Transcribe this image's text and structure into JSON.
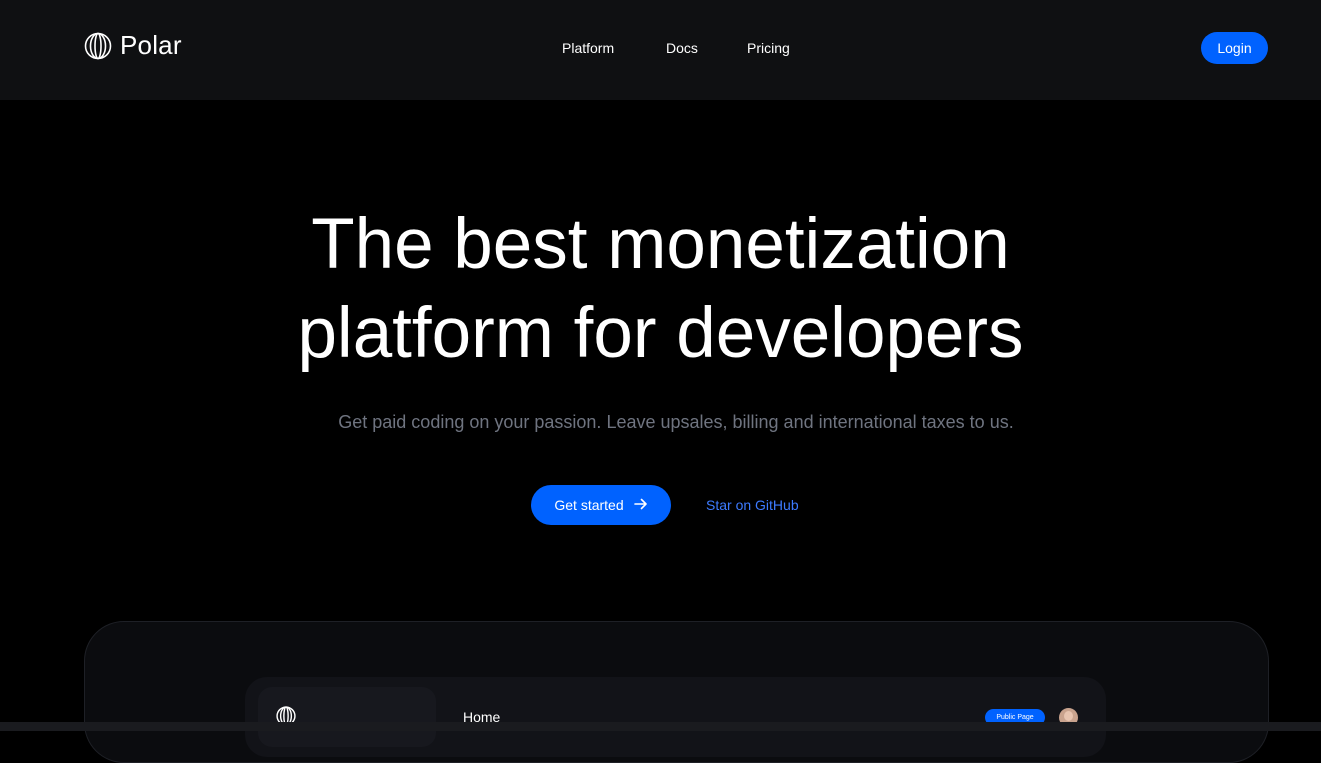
{
  "header": {
    "brand": "Polar",
    "logo_icon": "polar-globe-icon",
    "nav": [
      "Platform",
      "Docs",
      "Pricing"
    ],
    "login": "Login"
  },
  "hero": {
    "title_line1": "The best monetization",
    "title_line2": "platform for developers",
    "subtitle": "Get paid coding on your passion. Leave upsales, billing and international taxes to us.",
    "cta_primary": "Get started",
    "cta_primary_icon": "arrow-right-icon",
    "cta_secondary": "Star on GitHub"
  },
  "preview": {
    "page_title": "Home",
    "badge": "Public Page",
    "logo_icon": "polar-globe-icon",
    "avatar_icon": "user-avatar"
  },
  "colors": {
    "accent": "#0062ff",
    "link": "#3d7bff",
    "subtitle": "#6f7480",
    "background": "#000000",
    "header_bg": "#0f1012"
  }
}
